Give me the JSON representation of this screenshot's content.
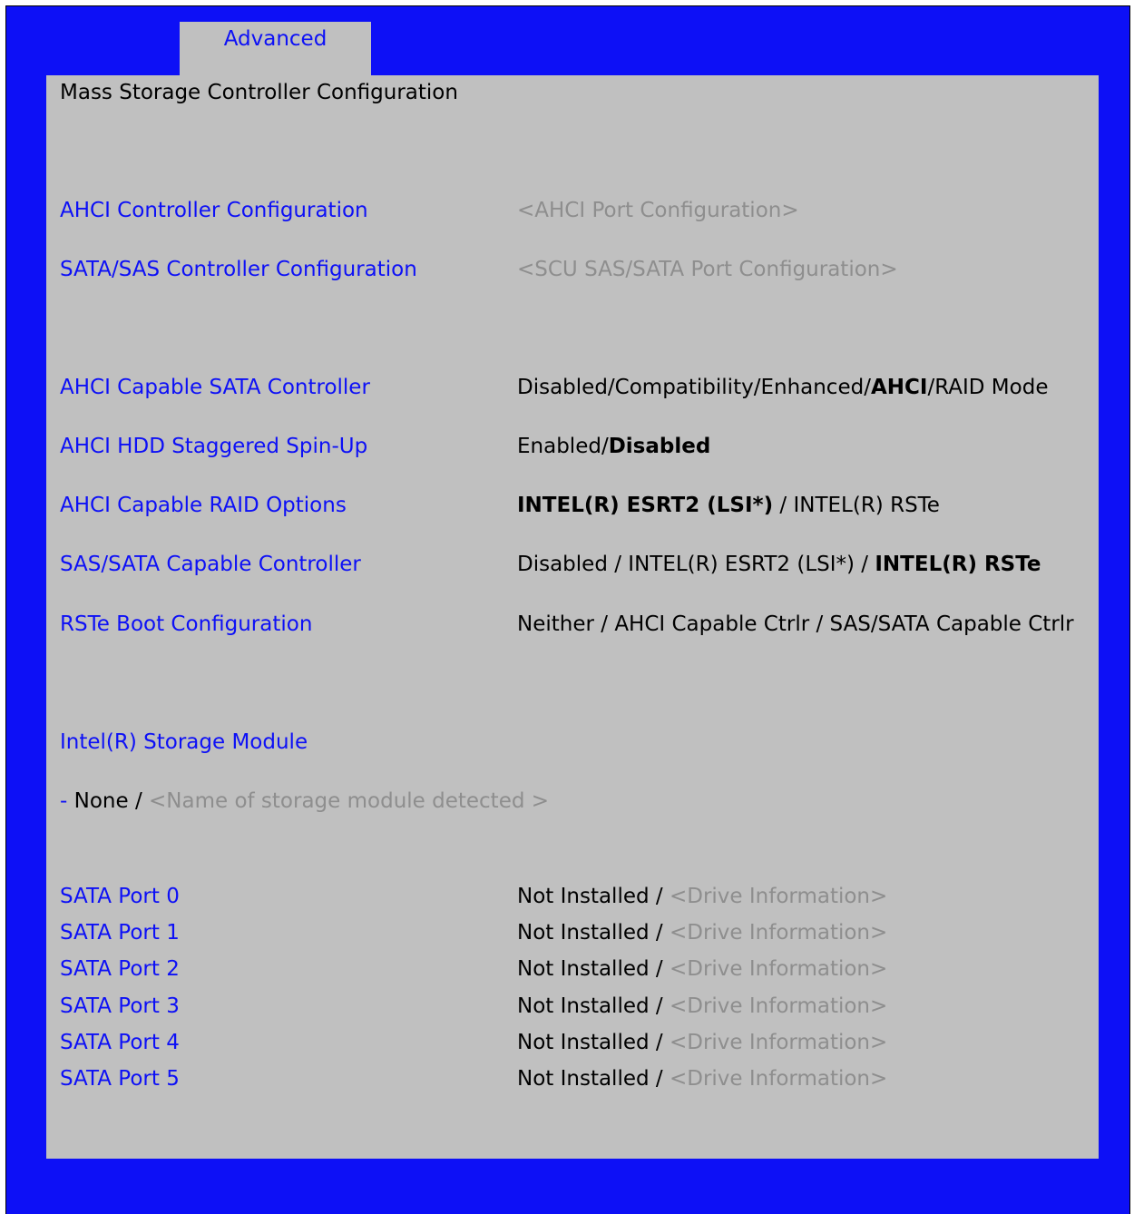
{
  "tab": {
    "label": "Advanced"
  },
  "page_title": "Mass Storage Controller Configuration",
  "submenus": [
    {
      "label": "AHCI Controller Configuration",
      "value": "<AHCI Port Configuration>"
    },
    {
      "label": "SATA/SAS Controller Configuration",
      "value": "<SCU SAS/SATA Port Configuration>"
    }
  ],
  "settings": {
    "ahci_capable_sata": {
      "label": "AHCI Capable SATA Controller",
      "opt_pre": "Disabled/Compatibility/Enhanced/",
      "opt_sel": "AHCI",
      "opt_post": "/RAID Mode"
    },
    "ahci_staggered": {
      "label": "AHCI HDD Staggered Spin-Up",
      "opt_pre": "Enabled/",
      "opt_sel": "Disabled"
    },
    "ahci_raid_options": {
      "label": "AHCI Capable RAID Options",
      "opt_sel": "INTEL(R) ESRT2 (LSI*)",
      "opt_post": " / INTEL(R) RSTe"
    },
    "sas_sata_controller": {
      "label": "SAS/SATA Capable Controller",
      "opt_pre": "Disabled / INTEL(R) ESRT2 (LSI*) / ",
      "opt_sel": "INTEL(R) RSTe"
    },
    "rste_boot": {
      "label": "RSTe Boot Configuration",
      "value": "Neither / AHCI Capable Ctrlr / SAS/SATA Capable Ctrlr"
    }
  },
  "storage_module": {
    "label": "Intel(R) Storage Module",
    "dash": "- ",
    "none": "None /",
    "detected": " <Name of storage module detected >"
  },
  "ports": [
    {
      "label": "SATA Port 0",
      "status": "Not Installed /",
      "info": " <Drive Information>"
    },
    {
      "label": "SATA Port 1",
      "status": "Not Installed /",
      "info": " <Drive Information>"
    },
    {
      "label": "SATA Port 2",
      "status": "Not Installed /",
      "info": " <Drive Information>"
    },
    {
      "label": "SATA Port 3",
      "status": "Not Installed /",
      "info": " <Drive Information>"
    },
    {
      "label": "SATA Port 4",
      "status": "Not Installed /",
      "info": " <Drive Information>"
    },
    {
      "label": "SATA Port 5",
      "status": "Not Installed /",
      "info": " <Drive Information>"
    }
  ],
  "colors": {
    "frame_blue": "#0d10f6",
    "panel_gray": "#c0c0c0",
    "muted_text": "#8e8e8e"
  }
}
